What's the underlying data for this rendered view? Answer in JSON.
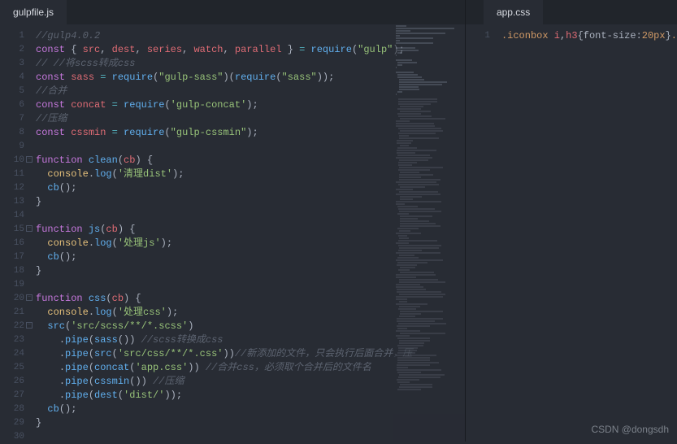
{
  "left": {
    "tab": "gulpfile.js",
    "lines": [
      {
        "n": 1,
        "html": "<span class='c-comment'>//gulp4.0.2</span>"
      },
      {
        "n": 2,
        "html": "<span class='c-keyword'>const</span> <span class='c-punct'>{ </span><span class='c-var'>src</span><span class='c-punct'>, </span><span class='c-var'>dest</span><span class='c-punct'>, </span><span class='c-var'>series</span><span class='c-punct'>, </span><span class='c-var'>watch</span><span class='c-punct'>, </span><span class='c-var'>parallel</span><span class='c-punct'> } </span><span class='c-op'>=</span> <span class='c-func'>require</span><span class='c-punct'>(</span><span class='c-string'>\"gulp\"</span><span class='c-punct'>);</span>"
      },
      {
        "n": 3,
        "html": "<span class='c-comment'>// //将scss转成css</span>"
      },
      {
        "n": 4,
        "html": "<span class='c-keyword'>const</span> <span class='c-var'>sass</span> <span class='c-op'>=</span> <span class='c-func'>require</span><span class='c-punct'>(</span><span class='c-string'>\"gulp-sass\"</span><span class='c-punct'>)(</span><span class='c-func'>require</span><span class='c-punct'>(</span><span class='c-string'>\"sass\"</span><span class='c-punct'>));</span>"
      },
      {
        "n": 5,
        "html": "<span class='c-comment'>//合并</span>"
      },
      {
        "n": 6,
        "html": "<span class='c-keyword'>const</span> <span class='c-var'>concat</span> <span class='c-op'>=</span> <span class='c-func'>require</span><span class='c-punct'>(</span><span class='c-string'>'gulp-concat'</span><span class='c-punct'>);</span>"
      },
      {
        "n": 7,
        "html": "<span class='c-comment'>//压缩</span>"
      },
      {
        "n": 8,
        "html": "<span class='c-keyword'>const</span> <span class='c-var'>cssmin</span> <span class='c-op'>=</span> <span class='c-func'>require</span><span class='c-punct'>(</span><span class='c-string'>\"gulp-cssmin\"</span><span class='c-punct'>);</span>"
      },
      {
        "n": 9,
        "html": ""
      },
      {
        "n": 10,
        "fold": true,
        "html": "<span class='c-keyword'>function</span> <span class='c-func'>clean</span><span class='c-punct'>(</span><span class='c-var'>cb</span><span class='c-punct'>) {</span>"
      },
      {
        "n": 11,
        "html": "  <span class='c-param'>console</span><span class='c-punct'>.</span><span class='c-func'>log</span><span class='c-punct'>(</span><span class='c-string'>'清理dist'</span><span class='c-punct'>);</span>"
      },
      {
        "n": 12,
        "html": "  <span class='c-func'>cb</span><span class='c-punct'>();</span>"
      },
      {
        "n": 13,
        "html": "<span class='c-punct'>}</span>"
      },
      {
        "n": 14,
        "html": ""
      },
      {
        "n": 15,
        "fold": true,
        "html": "<span class='c-keyword'>function</span> <span class='c-func'>js</span><span class='c-punct'>(</span><span class='c-var'>cb</span><span class='c-punct'>) {</span>"
      },
      {
        "n": 16,
        "html": "  <span class='c-param'>console</span><span class='c-punct'>.</span><span class='c-func'>log</span><span class='c-punct'>(</span><span class='c-string'>'处理js'</span><span class='c-punct'>);</span>"
      },
      {
        "n": 17,
        "html": "  <span class='c-func'>cb</span><span class='c-punct'>();</span>"
      },
      {
        "n": 18,
        "html": "<span class='c-punct'>}</span>"
      },
      {
        "n": 19,
        "html": ""
      },
      {
        "n": 20,
        "fold": true,
        "html": "<span class='c-keyword'>function</span> <span class='c-func'>css</span><span class='c-punct'>(</span><span class='c-var'>cb</span><span class='c-punct'>) {</span>"
      },
      {
        "n": 21,
        "html": "  <span class='c-param'>console</span><span class='c-punct'>.</span><span class='c-func'>log</span><span class='c-punct'>(</span><span class='c-string'>'处理css'</span><span class='c-punct'>);</span>"
      },
      {
        "n": 22,
        "fold": true,
        "html": "  <span class='c-func'>src</span><span class='c-punct'>(</span><span class='c-string'>'src/scss/**/*.scss'</span><span class='c-punct'>)</span>"
      },
      {
        "n": 23,
        "html": "    <span class='c-punct'>.</span><span class='c-func'>pipe</span><span class='c-punct'>(</span><span class='c-func'>sass</span><span class='c-punct'>())</span> <span class='c-comment'>//scss转换成css</span>"
      },
      {
        "n": 24,
        "html": "    <span class='c-punct'>.</span><span class='c-func'>pipe</span><span class='c-punct'>(</span><span class='c-func'>src</span><span class='c-punct'>(</span><span class='c-string'>'src/css/**/*.css'</span><span class='c-punct'>))</span><span class='c-comment'>//新添加的文件，只会执行后面合并，压</span>"
      },
      {
        "n": 25,
        "html": "    <span class='c-punct'>.</span><span class='c-func'>pipe</span><span class='c-punct'>(</span><span class='c-func'>concat</span><span class='c-punct'>(</span><span class='c-string'>'app.css'</span><span class='c-punct'>))</span> <span class='c-comment'>//合并css，必须取个合并后的文件名</span>"
      },
      {
        "n": 26,
        "html": "    <span class='c-punct'>.</span><span class='c-func'>pipe</span><span class='c-punct'>(</span><span class='c-func'>cssmin</span><span class='c-punct'>())</span> <span class='c-comment'>//压缩</span>"
      },
      {
        "n": 27,
        "html": "    <span class='c-punct'>.</span><span class='c-func'>pipe</span><span class='c-punct'>(</span><span class='c-func'>dest</span><span class='c-punct'>(</span><span class='c-string'>'dist/'</span><span class='c-punct'>));</span>"
      },
      {
        "n": 28,
        "html": "  <span class='c-func'>cb</span><span class='c-punct'>();</span>"
      },
      {
        "n": 29,
        "html": "<span class='c-punct'>}</span>"
      },
      {
        "n": 30,
        "html": ""
      }
    ]
  },
  "right": {
    "tab": "app.css",
    "lines": [
      {
        "n": 1,
        "html": "<span class='c-prop'>.iconbox</span> <span class='c-var'>i</span><span class='c-punct'>,</span><span class='c-var'>h3</span><span class='c-punct'>{</span><span class='c-punct'>font-size</span><span class='c-punct'>:</span><span class='c-num'>20px</span><span class='c-punct'>}</span><span class='c-prop'>.</span>"
      }
    ]
  },
  "watermark": "CSDN @dongsdh"
}
